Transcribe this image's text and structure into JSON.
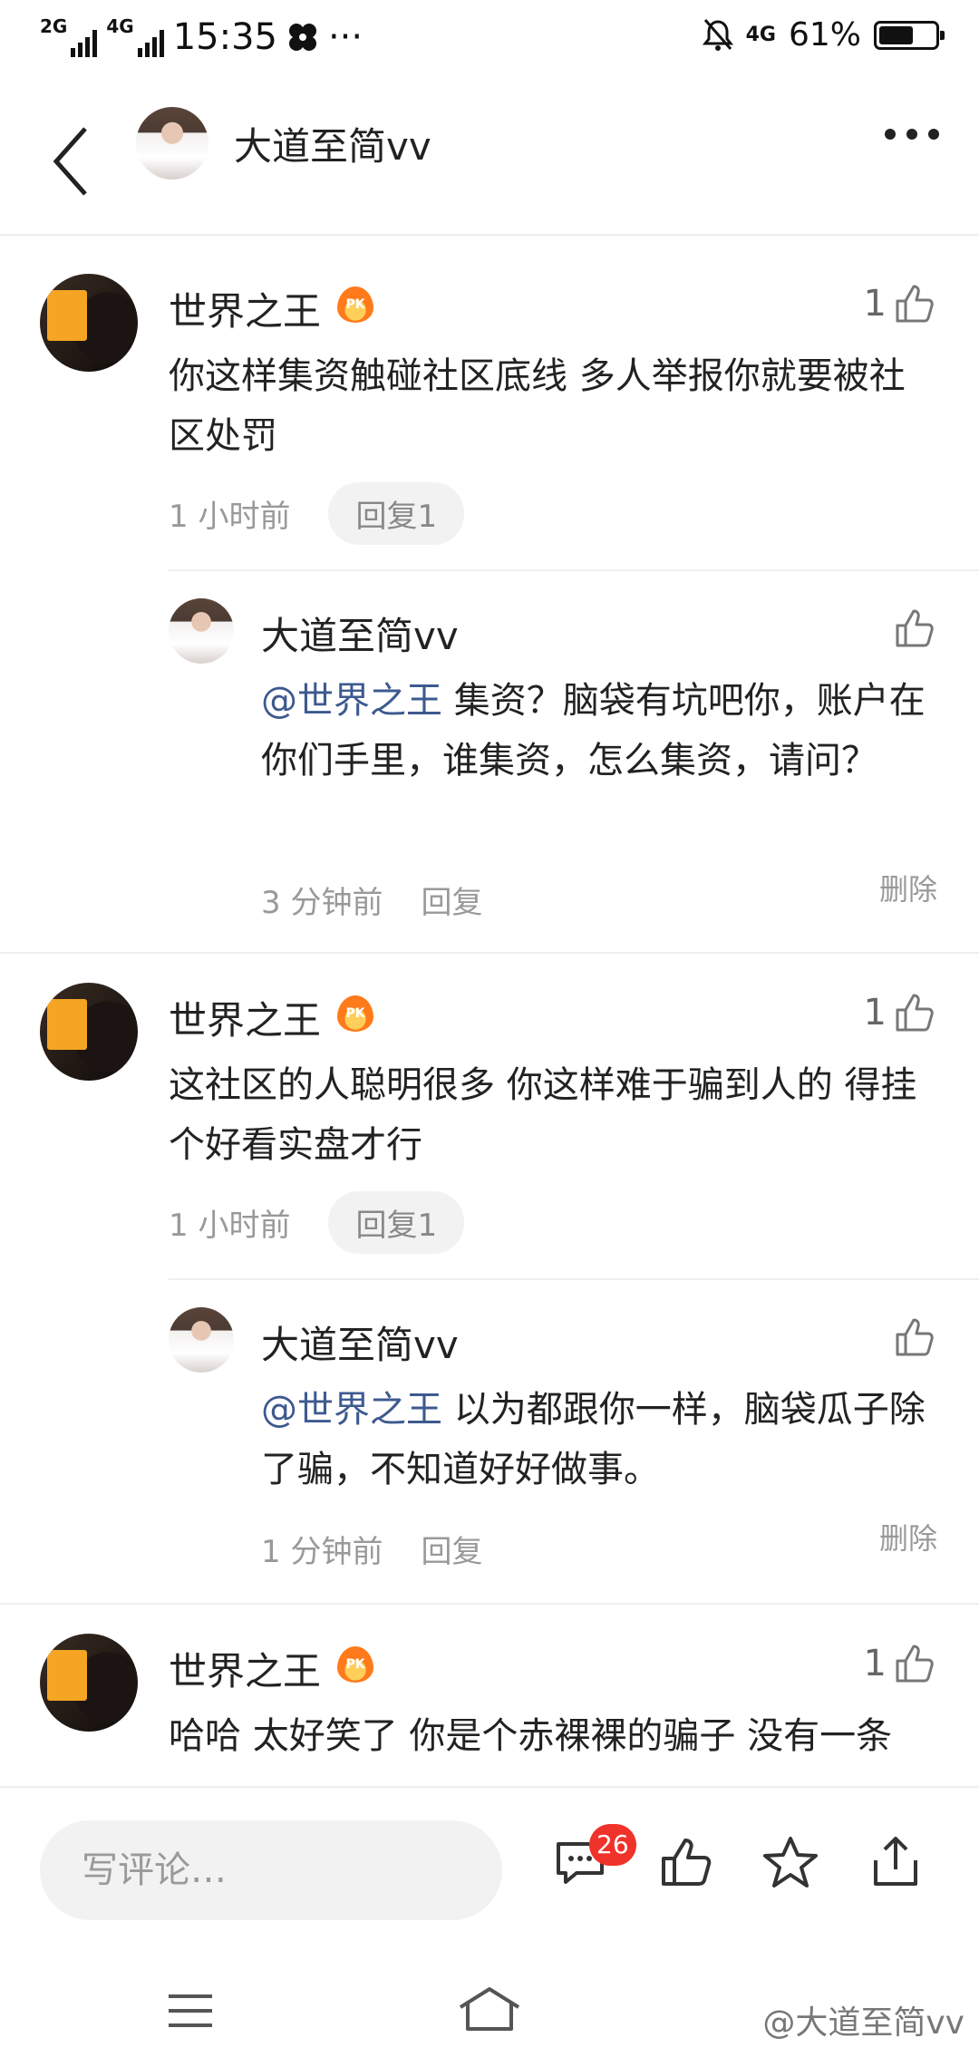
{
  "status_bar": {
    "net1": "2G",
    "net2": "4G",
    "time": "15:35",
    "dots": "···",
    "lte": "4G",
    "battery": "61%",
    "battery_level": 0.61
  },
  "header": {
    "title": "大道至简vv"
  },
  "threads": [
    {
      "author": "世界之王",
      "badge": "PK",
      "likes": "1",
      "text": "你这样集资触碰社区底线 多人举报你就要被社区处罚",
      "time": "1 小时前",
      "reply_label": "回复1",
      "reply": {
        "author": "大道至简vv",
        "mention": "@世界之王",
        "text": " 集资？脑袋有坑吧你，账户在你们手里，谁集资，怎么集资，请问？",
        "time": "3 分钟前",
        "reply_label": "回复",
        "delete_label": "删除"
      }
    },
    {
      "author": "世界之王",
      "badge": "PK",
      "likes": "1",
      "text": "这社区的人聪明很多 你这样难于骗到人的 得挂个好看实盘才行",
      "time": "1 小时前",
      "reply_label": "回复1",
      "reply": {
        "author": "大道至简vv",
        "mention": "@世界之王",
        "text": " 以为都跟你一样，脑袋瓜子除了骗，不知道好好做事。",
        "time": "1 分钟前",
        "reply_label": "回复",
        "delete_label": "删除"
      }
    },
    {
      "author": "世界之王",
      "badge": "PK",
      "likes": "1",
      "text": "哈哈 太好笑了 你是个赤裸裸的骗子 没有一条"
    }
  ],
  "action_bar": {
    "placeholder": "写评论…",
    "comment_count": "26"
  },
  "watermark": "@大道至简vv",
  "colors": {
    "mention": "#3d5a8f",
    "badge": "#f0332a",
    "pk": "#ff7a1a"
  }
}
